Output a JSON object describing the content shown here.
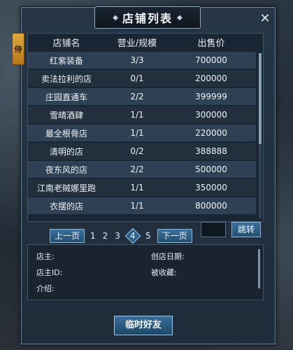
{
  "window": {
    "title": "店铺列表",
    "side_tab": "侍"
  },
  "table": {
    "headers": [
      "店铺名",
      "营业/规模",
      "出售价"
    ],
    "rows": [
      {
        "name": "红紫装备",
        "scale": "3/3",
        "price": "700000"
      },
      {
        "name": "卖法拉利的店",
        "scale": "0/1",
        "price": "200000"
      },
      {
        "name": "庄园直通车",
        "scale": "2/2",
        "price": "399999"
      },
      {
        "name": "雪晴酒肆",
        "scale": "1/1",
        "price": "300000"
      },
      {
        "name": "最全根骨店",
        "scale": "1/1",
        "price": "220000"
      },
      {
        "name": "清明的店",
        "scale": "0/2",
        "price": "388888"
      },
      {
        "name": "夜东风的店",
        "scale": "2/2",
        "price": "500000"
      },
      {
        "name": "江南老贼娜里跑",
        "scale": "1/1",
        "price": "350000"
      },
      {
        "name": "衣摆的店",
        "scale": "1/1",
        "price": "800000"
      }
    ]
  },
  "pager": {
    "prev_label": "上一页",
    "pages": [
      "1",
      "2",
      "3",
      "4",
      "5"
    ],
    "current": "4",
    "next_label": "下一页",
    "jump_label": "跳转"
  },
  "info": {
    "owner_label": "店主:",
    "open_date_label": "创店日期:",
    "owner_id_label": "店主ID:",
    "favorited_label": "被收藏:",
    "intro_label": "介绍:"
  },
  "actions": {
    "temp_friend_label": "临时好友"
  }
}
